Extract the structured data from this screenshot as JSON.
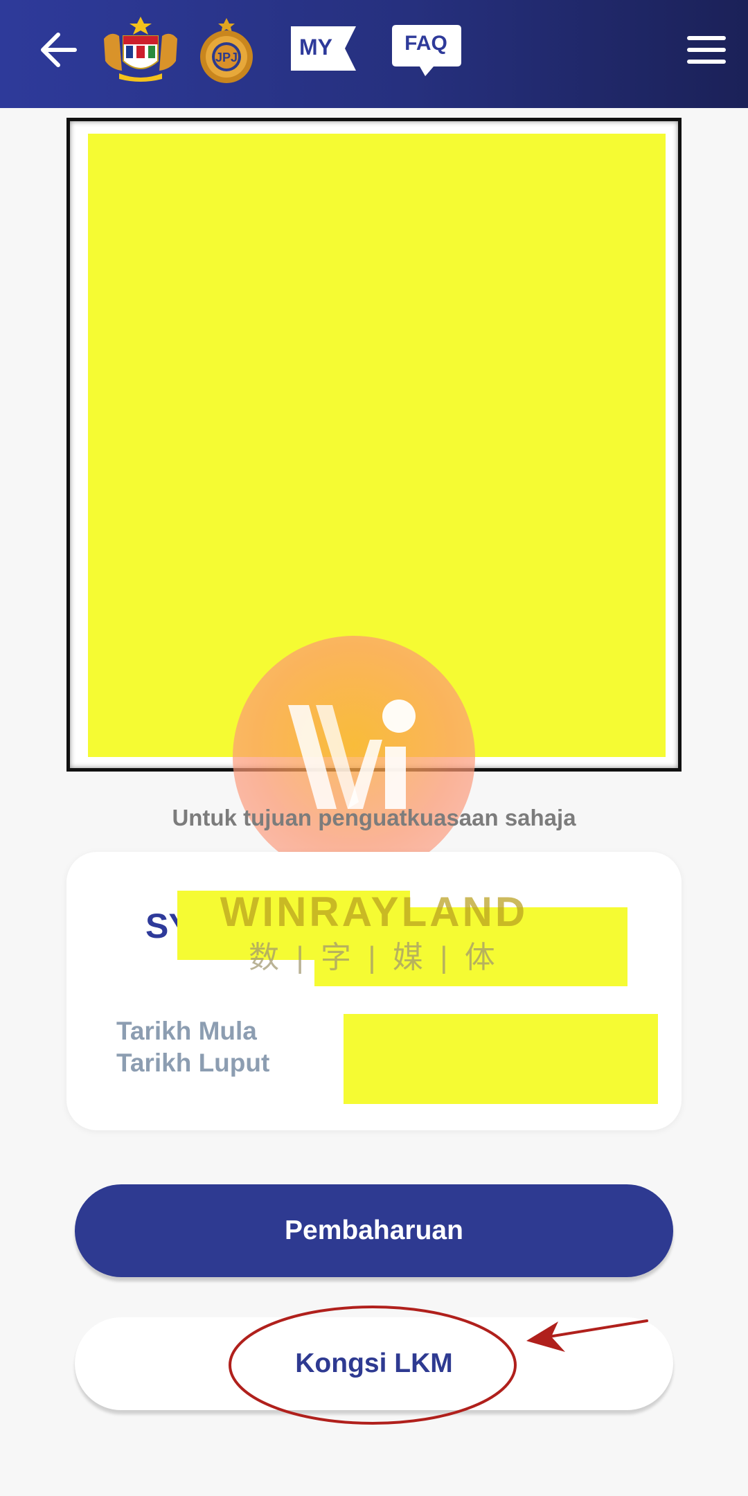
{
  "header": {
    "back_icon": "arrow-left-icon",
    "emblem_primary": "malaysia-coat-of-arms-logo",
    "emblem_secondary": "jpj-emblem-logo",
    "language_label": "MY",
    "faq_label": "FAQ",
    "menu_icon": "hamburger-menu-icon",
    "colors": {
      "gradient_start": "#2e3a9a",
      "gradient_end": "#1b2158"
    }
  },
  "license": {
    "caption": "Untuk tujuan penguatkuasaan sahaja",
    "redaction_color": "#f5fb33"
  },
  "card": {
    "holder_name_partial": "SY",
    "start_date_label": "Tarikh Mula",
    "expiry_date_label": "Tarikh Luput"
  },
  "watermark": {
    "brand": "WINRAYLAND",
    "subtitle": "数 | 字 | 媒 | 体"
  },
  "actions": {
    "renew_label": "Pembaharuan",
    "share_label": "Kongsi LKM",
    "primary_color": "#2e3a91"
  },
  "annotation": {
    "color": "#b0201c",
    "target": "share-button"
  }
}
